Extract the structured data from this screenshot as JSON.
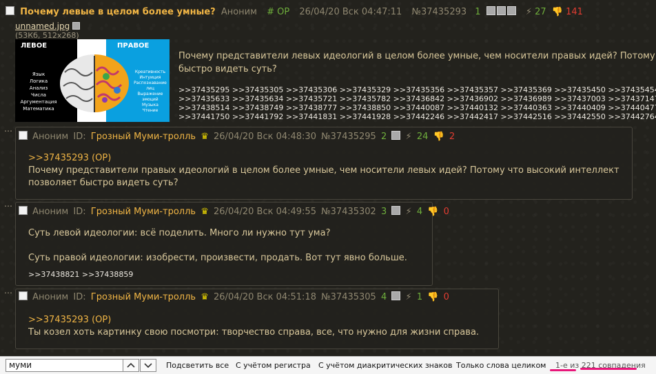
{
  "op": {
    "subject": "Почему левые в целом более умные?",
    "author": "Аноним",
    "op_tag": "# OP",
    "datetime": "26/04/20 Вск 04:47:11",
    "num": "№37435293",
    "replies_count": "1",
    "likes": "27",
    "dislikes": "141",
    "file": {
      "name": "unnamed.jpg",
      "meta": "(53Кб, 512x268)"
    },
    "thumb": {
      "left_title": "ЛЕВОЕ",
      "right_title": "ПРАВОЕ",
      "left_words": [
        "Язык",
        "Логика",
        "Анализ",
        "Числа",
        "Аргументация",
        "Математика"
      ],
      "right_words": [
        "Креативность",
        "Интуиция",
        "Распознавание",
        "лиц",
        "Выражение",
        "эмоций",
        "Музыка",
        "Чтение"
      ]
    },
    "text_lines": [
      "Почему представители левых идеологий в целом более умные, чем носители правых идей? Потому ч",
      "быстро видеть суть?"
    ],
    "refs_lines": [
      ">>37435295 >>37435305 >>37435306 >>37435329 >>37435356 >>37435357 >>37435369 >>37435450 >>37435454",
      ">>37435633 >>37435634 >>37435721 >>37435782 >>37436842 >>37436902 >>37436989 >>37437003 >>37437147",
      ">>37438514 >>37438749 >>37438777 >>37438850 >>37440087 >>37440132 >>37440363 >>37440409 >>37440477",
      ">>37441750 >>37441792 >>37441831 >>37441928 >>37442246 >>37442417 >>37442516 >>37442550 >>37442764"
    ]
  },
  "replies": [
    {
      "author": "Аноним",
      "id_label": "ID:",
      "id_name": "Грозный Муми-тролль",
      "datetime": "26/04/20 Вск 04:48:30",
      "num": "№37435295",
      "replies_count": "2",
      "likes": "24",
      "dislikes": "2",
      "reflink": ">>37435293 (OP)",
      "lines": [
        "Почему представители правых идеологий в целом более умные, чем носители левых идей? Потому что высокий интеллект",
        "позволяет быстро видеть суть?"
      ],
      "backrefs": ""
    },
    {
      "author": "Аноним",
      "id_label": "ID:",
      "id_name": "Грозный Муми-тролль",
      "datetime": "26/04/20 Вск 04:49:55",
      "num": "№37435302",
      "replies_count": "3",
      "likes": "4",
      "dislikes": "0",
      "reflink": "",
      "lines": [
        "Суть левой идеологии: всё поделить. Много ли нужно тут ума?",
        "",
        "Суть правой идеологии: изобрести, произвести, продать. Вот тут явно больше."
      ],
      "backrefs": ">>37438821 >>37438859"
    },
    {
      "author": "Аноним",
      "id_label": "ID:",
      "id_name": "Грозный Муми-тролль",
      "datetime": "26/04/20 Вск 04:51:18",
      "num": "№37435305",
      "replies_count": "4",
      "likes": "1",
      "dislikes": "0",
      "reflink": ">>37435293 (OP)",
      "lines": [
        "Ты козел хоть картинку свою посмотри: творчество справа, все, что нужно для жизни справа."
      ],
      "backrefs": ""
    }
  ],
  "findbar": {
    "query": "муми",
    "highlight_all": "Подсветить все",
    "match_case": "С учётом регистра",
    "match_diacritics": "С учётом диакритических знаков",
    "whole_words": "Только слова целиком",
    "matches": "1-е из 221 совпадения"
  },
  "colors": {
    "subject": "#f0b545",
    "like": "#6fae3c",
    "dislike": "#e23d32",
    "annotation": "#e8167a"
  },
  "icons": [
    "checkbox-icon",
    "gallery-icon",
    "play-icon",
    "lightning-icon",
    "thumbs-down-icon",
    "crown-icon",
    "chevron-up-icon",
    "chevron-down-icon"
  ]
}
